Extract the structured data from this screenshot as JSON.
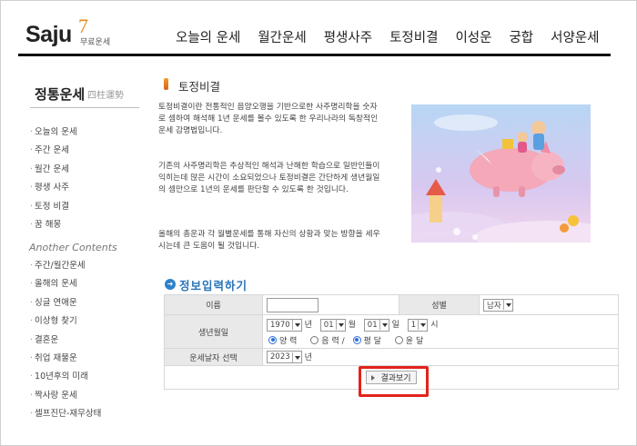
{
  "header": {
    "logo_text": "Saju",
    "logo_number": "7",
    "logo_sub": "무료운세",
    "nav": [
      "오늘의 운세",
      "월간운세",
      "평생사주",
      "토정비결",
      "이성운",
      "궁합",
      "서양운세"
    ]
  },
  "sidebar": {
    "title": "정통운세",
    "title_sub": "四柱運勢",
    "items": [
      "오늘의 운세",
      "주간 운세",
      "월간 운세",
      "평생 사주",
      "토정 비결",
      "꿈 해몽"
    ],
    "section_title": "Another Contents",
    "items2": [
      "주간/월간운세",
      "올해의 운세",
      "싱글 연애운",
      "이상형 찾기",
      "결혼운",
      "취업 재물운",
      "10년후의 미래",
      "짝사랑 운세",
      "셀프진단-재무상태"
    ]
  },
  "main": {
    "title": "토정비결",
    "paragraph1": "토정비결이란 전통적인 음양오행을 기반으로한 사주명리학을 숫자로 셈하여 해석해 1년 운세를 볼수 있도록 한 우리나라의 독창적인 운세 감명법입니다.",
    "paragraph2": "기존의 사주명리학은 추상적인 해석과 난해한 학습으로 일반인들이 익히는데 많은 시간이 소요되었으나 토정비결은 간단하게 생년월일의 셈만으로 1년의 운세를 판단할 수 있도록 한 것입니다.",
    "paragraph3": "올해의 총운과 각 월별운세를 통해 자신의 상황과 맞는 방향을 세우시는데 큰 도움이 될 것입니다."
  },
  "form": {
    "title": "정보입력하기",
    "name_label": "이름",
    "name_value": "",
    "gender_label": "성별",
    "gender_value": "남자",
    "birth_label": "생년월일",
    "year_value": "1970",
    "year_unit": "년",
    "month_value": "01",
    "month_unit": "월",
    "day_value": "01",
    "day_unit": "일",
    "hour_value": "1",
    "hour_unit": "시",
    "calendar_options": [
      "양 력",
      "음 력 /",
      "평 달",
      "윤 달"
    ],
    "calendar_selected": [
      "양 력",
      "평 달"
    ],
    "fortune_year_label": "운세날자 선택",
    "fortune_year_value": "2023",
    "fortune_year_unit": "년",
    "submit_label": "결과보기"
  },
  "colors": {
    "accent_orange": "#e08a1e",
    "form_title_blue": "#2a74b8",
    "highlight_red": "#e2231a",
    "radio_blue": "#2f6fd6"
  }
}
